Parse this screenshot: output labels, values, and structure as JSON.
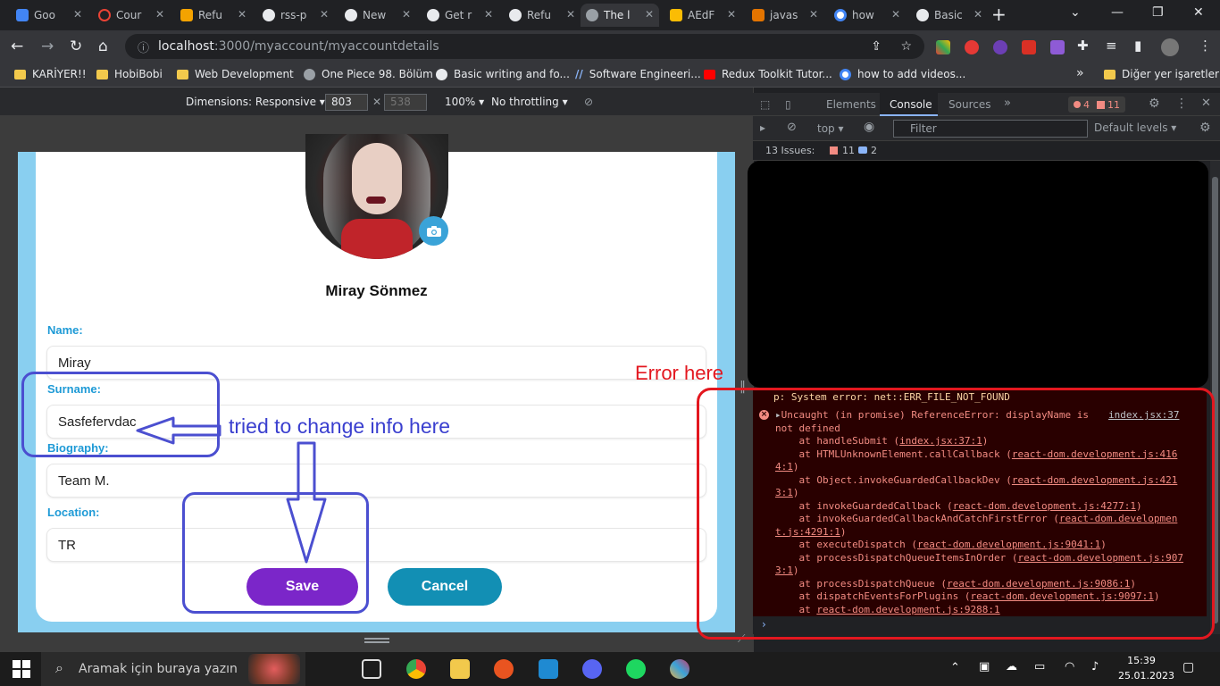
{
  "browser": {
    "tabs": [
      {
        "label": "Goo",
        "color": "#4285f4"
      },
      {
        "label": "Cour",
        "color": "#ea4335"
      },
      {
        "label": "Refu",
        "color": "#f4a300"
      },
      {
        "label": "rss-p",
        "color": "#e8eaed"
      },
      {
        "label": "New",
        "color": "#e8eaed"
      },
      {
        "label": "Get r",
        "color": "#e8eaed"
      },
      {
        "label": "Refu",
        "color": "#e8eaed"
      },
      {
        "label": "The l",
        "color": "#9aa0a6"
      },
      {
        "label": "AEdF",
        "color": "#fbbc04"
      },
      {
        "label": "javas",
        "color": "#e37400"
      },
      {
        "label": "how",
        "color": "#4285f4"
      },
      {
        "label": "Basic",
        "color": "#e8eaed"
      }
    ],
    "url_host": "localhost",
    "url_path": ":3000/myaccount/myaccountdetails",
    "bookmarks": [
      "KARİYER!!",
      "HobiBobi",
      "Web Development",
      "One Piece 98. Bölüm",
      "Basic writing and fo...",
      "Software Engineeri...",
      "Redux Toolkit Tutor...",
      "how to add videos..."
    ],
    "other_bookmarks": "Diğer yer işaretleri"
  },
  "device_toolbar": {
    "dimensions": "Dimensions: Responsive",
    "width": "803",
    "height": "538",
    "zoom": "100%",
    "throttling": "No throttling"
  },
  "page": {
    "profile_name": "Miray Sönmez",
    "fields": [
      {
        "label": "Name:",
        "value": "Miray"
      },
      {
        "label": "Surname:",
        "value": "Sasfefervdac"
      },
      {
        "label": "Biography:",
        "value": "Team M."
      },
      {
        "label": "Location:",
        "value": "TR"
      }
    ],
    "save_label": "Save",
    "cancel_label": "Cancel"
  },
  "devtools": {
    "tabs": [
      "Elements",
      "Console",
      "Sources"
    ],
    "error_count": "4",
    "issue_count": "11",
    "context": "top",
    "filter_placeholder": "Filter",
    "levels": "Default levels",
    "issues_label": "13 Issues:",
    "issues_errors": "11",
    "issues_info": "2",
    "system_error": "p: System error: net::ERR_FILE_NOT_FOUND",
    "error_header_1": "Uncaught (in promise) ReferenceError: displayName is",
    "error_header_2": "not defined",
    "error_source": "index.jsx:37",
    "stack": [
      {
        "text": "    at handleSubmit (",
        "link": "index.jsx:37:1",
        "end": ")"
      },
      {
        "text": "    at HTMLUnknownElement.callCallback (",
        "link": "react-dom.development.js:416",
        "end": ""
      },
      {
        "text": "",
        "link": "4:1",
        "end": ")"
      },
      {
        "text": "    at Object.invokeGuardedCallbackDev (",
        "link": "react-dom.development.js:421",
        "end": ""
      },
      {
        "text": "",
        "link": "3:1",
        "end": ")"
      },
      {
        "text": "    at invokeGuardedCallback (",
        "link": "react-dom.development.js:4277:1",
        "end": ")"
      },
      {
        "text": "    at invokeGuardedCallbackAndCatchFirstError (",
        "link": "react-dom.developmen",
        "end": ""
      },
      {
        "text": "",
        "link": "t.js:4291:1",
        "end": ")"
      },
      {
        "text": "    at executeDispatch (",
        "link": "react-dom.development.js:9041:1",
        "end": ")"
      },
      {
        "text": "    at processDispatchQueueItemsInOrder (",
        "link": "react-dom.development.js:907",
        "end": ""
      },
      {
        "text": "",
        "link": "3:1",
        "end": ")"
      },
      {
        "text": "    at processDispatchQueue (",
        "link": "react-dom.development.js:9086:1",
        "end": ")"
      },
      {
        "text": "    at dispatchEventsForPlugins (",
        "link": "react-dom.development.js:9097:1",
        "end": ")"
      },
      {
        "text": "    at ",
        "link": "react-dom.development.js:9288:1",
        "end": ""
      }
    ]
  },
  "annotations": {
    "error_here": "Error here",
    "tried_change": "tried to change info here"
  },
  "taskbar": {
    "search_placeholder": "Aramak için buraya yazın",
    "time": "15:39",
    "date": "25.01.2023"
  },
  "colors": {
    "accent_save": "#7b26c9",
    "accent_cancel": "#128fb4",
    "label_blue": "#1e9ad6",
    "annotation_blue": "#3a3fcf",
    "annotation_red": "#e3171f"
  }
}
